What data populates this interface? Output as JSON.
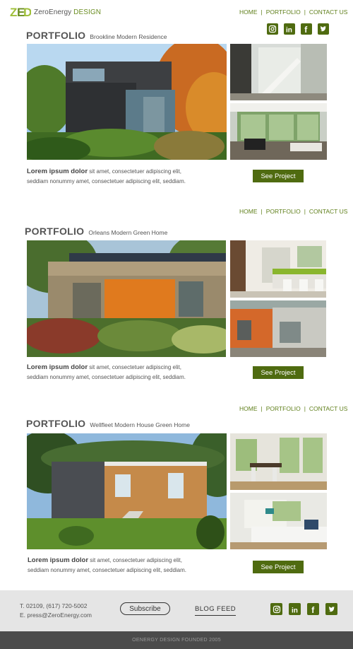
{
  "brand": {
    "name_prefix": "ZeroEnergy",
    "name_accent": "DESIGN",
    "accent_color": "#6b8e23",
    "button_color": "#4f6b10"
  },
  "nav": {
    "home": "HOME",
    "portfolio": "PORTFOLIO",
    "contact": "CONTACT US",
    "sep": "|"
  },
  "social_icons": [
    "instagram-icon",
    "linkedin-icon",
    "facebook-icon",
    "twitter-icon"
  ],
  "sections": [
    {
      "title": "PORTFOLIO",
      "subtitle": "Brookline Modern Residence",
      "desc_bold": "Lorem ipsum dolor",
      "desc_line1": " sit amet, consectetuer adipiscing elit,",
      "desc_line2": "seddiam nonummy amet, consectetuer adipiscing elit, seddiam.",
      "button": "See Project"
    },
    {
      "title": "PORTFOLIO",
      "subtitle": "Orleans Modern Green Home",
      "desc_bold": "Lorem ipsum dolor",
      "desc_line1": " sit amet, consectetuer adipiscing elit,",
      "desc_line2": "seddiam nonummy amet, consectetuer adipiscing elit, seddiam.",
      "button": "See Project"
    },
    {
      "title": "PORTFOLIO",
      "subtitle": "Wellfleet Modern House Green Home",
      "desc_bold": "Lorem ipsum dolor",
      "desc_line1": " sit amet, consectetuer adipiscing elit,",
      "desc_line2": "seddiam nonummy amet, consectetuer adipiscing elit, seddiam.",
      "button": "See Project"
    }
  ],
  "footer": {
    "phone": "T. 02109, (617) 720-5002",
    "email": "E. press@ZeroEnergy.com",
    "subscribe": "Subscribe",
    "blog_feed": "BLOG FEED",
    "founded": "OENERGY DESIGN FOUNDED 2005"
  }
}
